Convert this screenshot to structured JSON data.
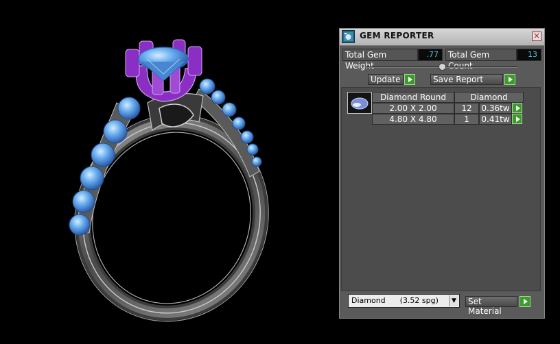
{
  "panel": {
    "title": "GEM REPORTER",
    "close_glyph": "×",
    "total_gem_weight_label": "Total Gem Weight",
    "total_gem_weight": ".77",
    "total_gem_count_label": "Total Gem Count",
    "total_gem_count": "13",
    "update_label": "Update",
    "save_report_label": "Save Report"
  },
  "report": {
    "headers": [
      "Diamond Round",
      "Diamond"
    ],
    "rows": [
      {
        "size": "2.00 X 2.00",
        "count": "12",
        "weight": "0.36tw"
      },
      {
        "size": "4.80 X 4.80",
        "count": "1",
        "weight": "0.41tw"
      }
    ]
  },
  "material": {
    "selected": "Diamond      (3.52 spg)",
    "set_material_label": "Set Material"
  },
  "colors": {
    "accent_value": "#4fc8e8",
    "button_green": "#3e9a2c",
    "prong_purple": "#8a2ec4",
    "gem_blue": "#5aa6ec",
    "metal_gray": "#7a7a7a"
  },
  "icons": [
    "gem-reporter-app-icon",
    "close-icon",
    "play-arrow-icon",
    "dropdown-arrow-icon",
    "gem-thumbnail-icon"
  ]
}
